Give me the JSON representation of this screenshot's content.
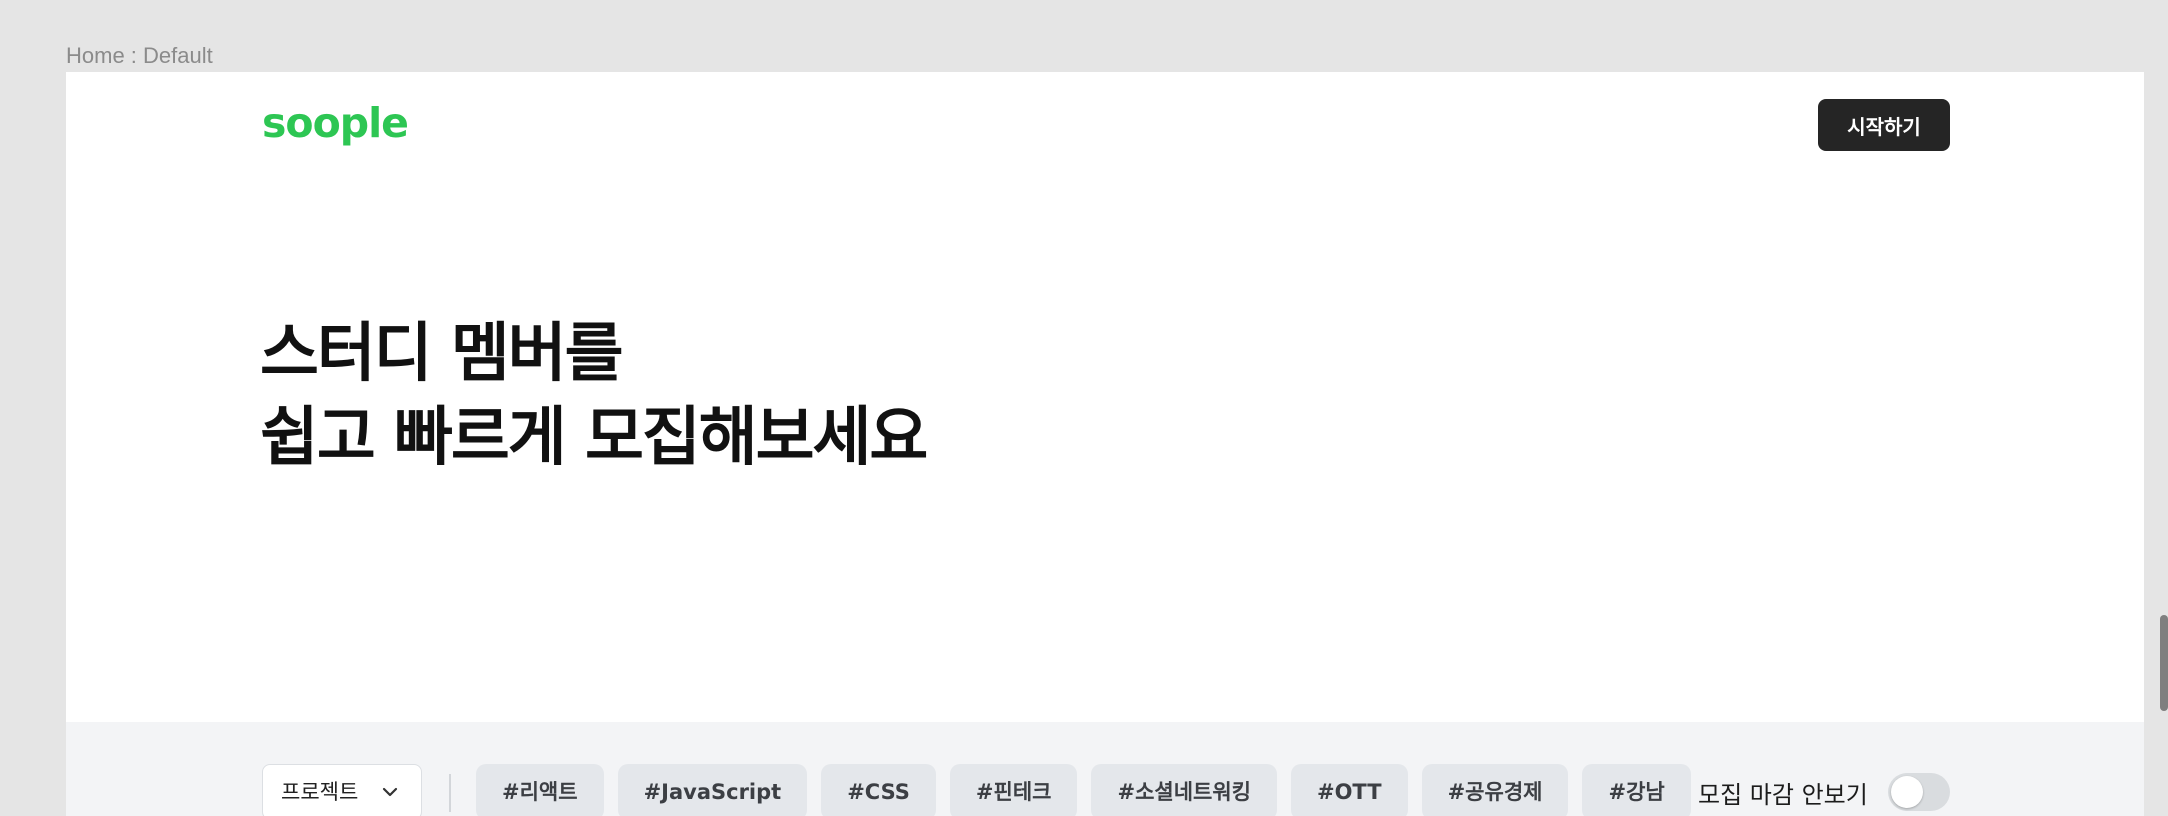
{
  "frame_label": "Home : Default",
  "header": {
    "logo": "soople",
    "start_button": "시작하기"
  },
  "hero": {
    "line1": "스터디 멤버를",
    "line2": "쉽고 빠르게 모집해보세요"
  },
  "filter": {
    "category": "프로젝트",
    "tags": [
      "#리액트",
      "#JavaScript",
      "#CSS",
      "#핀테크",
      "#소셜네트워킹",
      "#OTT",
      "#공유경제",
      "#강남"
    ],
    "hide_closed_label": "모집 마감 안보기",
    "hide_closed_on": false
  },
  "colors": {
    "brand": "#2dc653",
    "button_dark": "#252525",
    "tag_bg": "#e4e7eb",
    "filter_bg": "#f3f4f6"
  }
}
